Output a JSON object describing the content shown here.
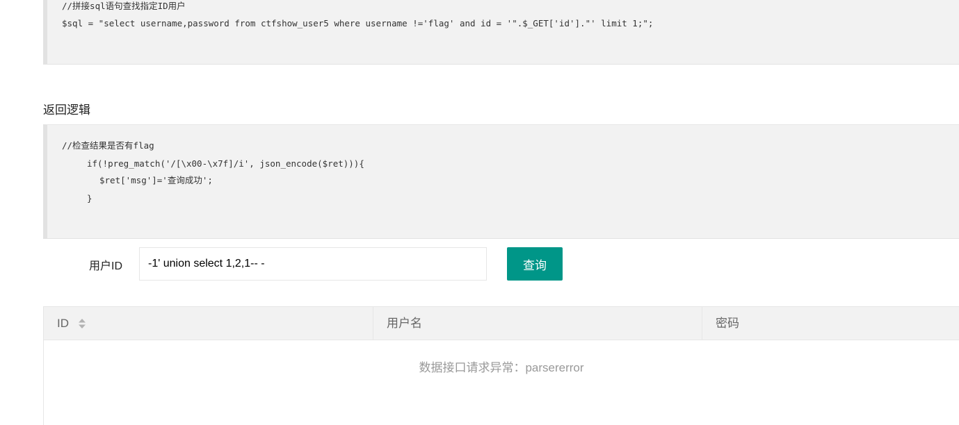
{
  "code_block_1": {
    "lines": [
      "//拼接sql语句查找指定ID用户",
      "$sql = \"select username,password from ctfshow_user5 where username !='flag' and id = '\".$_GET['id'].\"' limit 1;\";"
    ]
  },
  "section_title": "返回逻辑",
  "code_block_2": {
    "lines": [
      "//检查结果是否有flag",
      "if(!preg_match('/[\\x00-\\x7f]/i', json_encode($ret))){",
      "$ret['msg']='查询成功';",
      "}"
    ]
  },
  "form": {
    "label": "用户ID",
    "input_value": "-1' union select 1,2,1-- -",
    "button_label": "查询"
  },
  "table": {
    "columns": [
      "ID",
      "用户名",
      "密码"
    ],
    "empty_message": "数据接口请求异常：parsererror"
  },
  "colors": {
    "accent": "#009688",
    "code_bg": "#f2f2f2",
    "header_bg": "#f2f2f2"
  },
  "icons": {
    "sort": "sort-icon"
  }
}
